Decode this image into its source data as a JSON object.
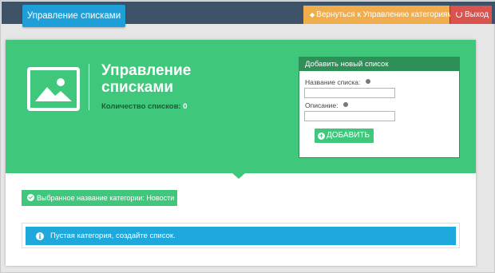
{
  "header": {
    "active_tab": "Управление списками",
    "back_button": "Вернуться к Управлению категориями",
    "exit_button": "Выход"
  },
  "hero": {
    "title": "Управление списками",
    "count_label": "Количество списков:",
    "count_value": "0",
    "icon": "image-icon"
  },
  "add_form": {
    "heading": "Добавить новый список",
    "name_label": "Название списка:",
    "name_value": "",
    "description_label": "Описание:",
    "description_value": "",
    "submit_label": "ДОБАВИТЬ"
  },
  "category": {
    "selected_text": "Выбранное название категории: Новости"
  },
  "alert": {
    "text": "Пустая категория, создайте список."
  },
  "colors": {
    "topbar": "#3f5368",
    "active_tab": "#1f9fd8",
    "back": "#f0ad4e",
    "exit": "#d9534f",
    "green": "#3fc77b",
    "dark_green": "#2e8f57",
    "info": "#1fa8dc"
  }
}
